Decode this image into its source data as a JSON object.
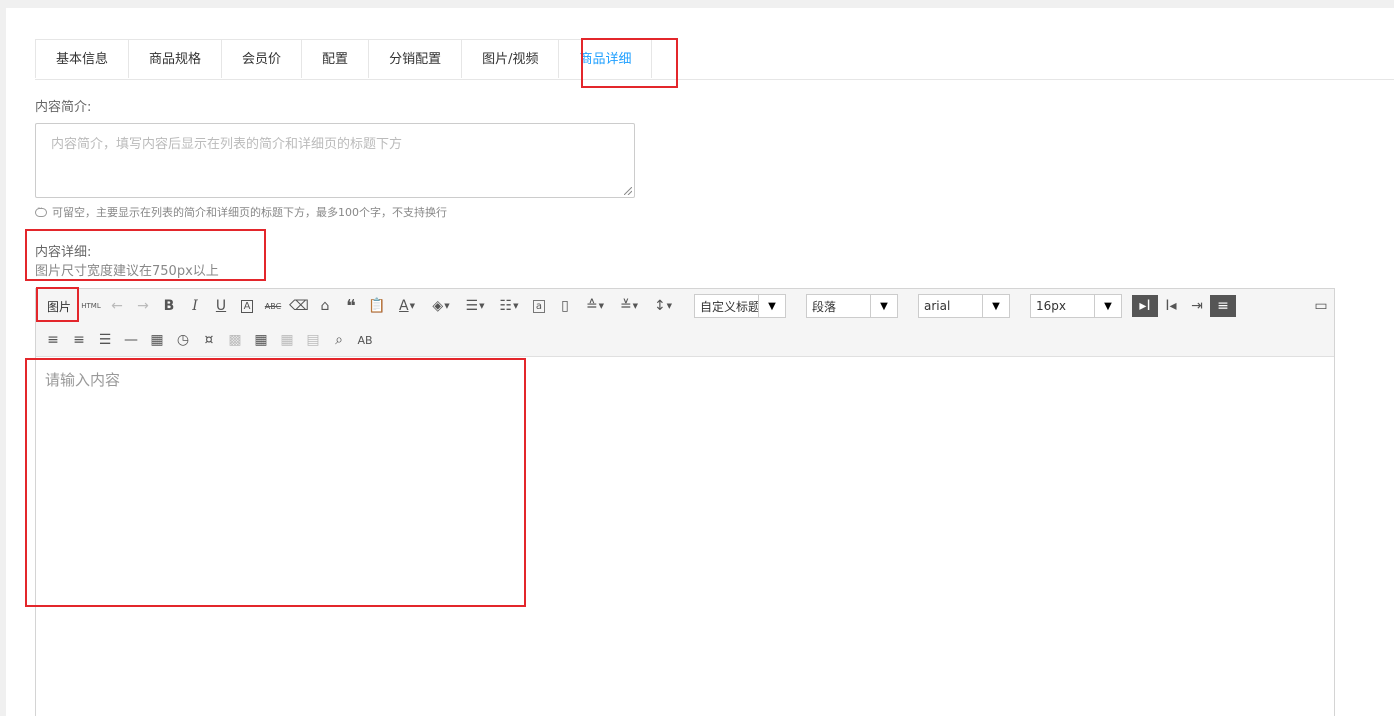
{
  "tabs": [
    {
      "label": "基本信息"
    },
    {
      "label": "商品规格"
    },
    {
      "label": "会员价"
    },
    {
      "label": "配置"
    },
    {
      "label": "分销配置"
    },
    {
      "label": "图片/视频"
    },
    {
      "label": "商品详细",
      "active": true
    }
  ],
  "summary": {
    "label": "内容简介:",
    "placeholder": "内容简介，填写内容后显示在列表的简介和详细页的标题下方",
    "hint": "可留空，主要显示在列表的简介和详细页的标题下方，最多100个字，不支持换行"
  },
  "detail": {
    "label": "内容详细:",
    "note": "图片尺寸宽度建议在750px以上"
  },
  "editor": {
    "image_button": "图片",
    "html_button": "HTML",
    "selects": {
      "heading": "自定义标题",
      "paragraph": "段落",
      "font": "arial",
      "size": "16px"
    },
    "placeholder": "请输入内容"
  },
  "accent_color": "#1E9FFF",
  "highlight_color": "#e3262b"
}
